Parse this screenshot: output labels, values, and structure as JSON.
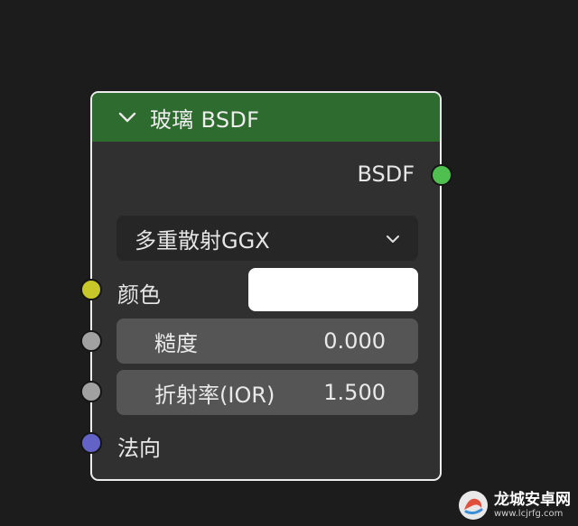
{
  "node": {
    "title": "玻璃 BSDF",
    "output_label": "BSDF",
    "distribution": {
      "selected": "多重散射GGX"
    },
    "inputs": {
      "color_label": "颜色",
      "color_value": "#ffffff",
      "roughness_label": "糙度",
      "roughness_value": "0.000",
      "ior_label": "折射率(IOR)",
      "ior_value": "1.500",
      "normal_label": "法向"
    },
    "colors": {
      "header": "#2e6b2e",
      "body": "#303030",
      "field": "#555555",
      "socket_shader": "#4fbf4f",
      "socket_color": "#c7c729",
      "socket_float": "#a1a1a1",
      "socket_vector": "#6363c7"
    },
    "icons": {
      "collapse": "chevron-down-icon",
      "dropdown": "chevron-down-icon"
    }
  },
  "watermark": {
    "title": "龙城安卓网",
    "url": "www.lcjrfg.com"
  }
}
